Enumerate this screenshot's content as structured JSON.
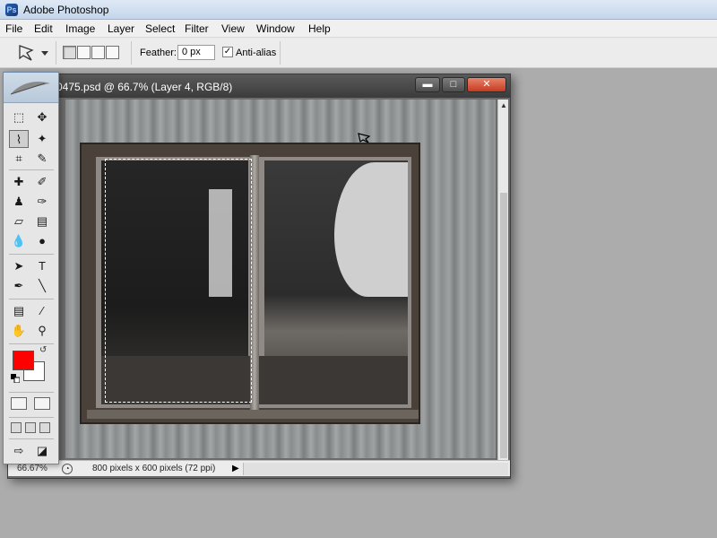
{
  "app": {
    "title": "Adobe Photoshop",
    "icon": "photoshop-icon"
  },
  "menubar": {
    "items": [
      "File",
      "Edit",
      "Image",
      "Layer",
      "Select",
      "Filter",
      "View",
      "Window",
      "Help"
    ]
  },
  "options": {
    "tool_icon": "polygonal-lasso-icon",
    "feather_label": "Feather:",
    "feather_value": "0 px",
    "antialias_label": "Anti-alias",
    "antialias_checked": true
  },
  "document": {
    "title": "0475.psd @ 66.7% (Layer 4, RGB/8)",
    "zoom": "66.67%",
    "info": "800 pixels x 600 pixels (72 ppi)",
    "window_buttons": [
      "minimize",
      "maximize",
      "close"
    ]
  },
  "toolbox": {
    "foreground_color": "#ff0000",
    "background_color": "#ffffff",
    "active_tool": "polygonal-lasso",
    "tools": [
      "marquee",
      "move",
      "lasso",
      "magic-wand",
      "crop",
      "slice",
      "healing",
      "brush",
      "stamp",
      "history-brush",
      "eraser",
      "gradient",
      "blur",
      "dodge",
      "path-select",
      "type",
      "pen",
      "line",
      "notes",
      "eyedropper",
      "hand",
      "zoom"
    ]
  }
}
